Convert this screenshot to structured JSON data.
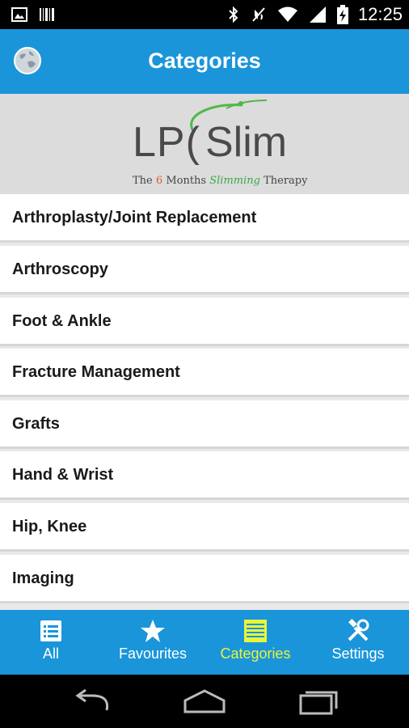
{
  "status_bar": {
    "time": "12:25",
    "left_icons": [
      "image-icon",
      "barcode-icon"
    ],
    "right_icons": [
      "bluetooth-icon",
      "mute-icon",
      "wifi-icon",
      "signal-icon",
      "battery-charging-icon"
    ]
  },
  "header": {
    "title": "Categories",
    "icon": "globe-icon"
  },
  "banner": {
    "logo_text": "LP(Slim",
    "tagline_prefix": "The",
    "tagline_number": "6",
    "tagline_middle": "Months",
    "tagline_script": "Slimming",
    "tagline_suffix": "Therapy"
  },
  "categories": [
    "Arthroplasty/Joint Replacement",
    "Arthroscopy",
    "Foot & Ankle",
    "Fracture Management",
    "Grafts",
    "Hand & Wrist",
    "Hip, Knee",
    "Imaging"
  ],
  "tabs": [
    {
      "label": "All",
      "icon": "list-icon",
      "active": false
    },
    {
      "label": "Favourites",
      "icon": "star-icon",
      "active": false
    },
    {
      "label": "Categories",
      "icon": "categories-icon",
      "active": true
    },
    {
      "label": "Settings",
      "icon": "tools-icon",
      "active": false
    }
  ],
  "colors": {
    "primary": "#1a95da",
    "active_tab": "#e8f53a",
    "banner_bg": "#dcdcdc"
  },
  "nav_bar": [
    "back-icon",
    "home-icon",
    "recents-icon"
  ]
}
